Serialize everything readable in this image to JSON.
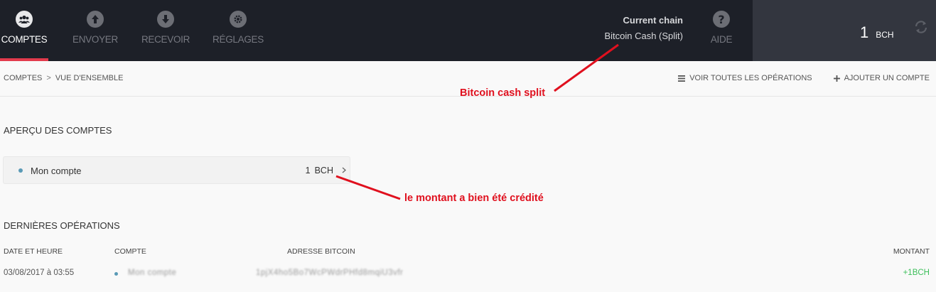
{
  "nav": {
    "items": [
      {
        "label": "COMPTES",
        "icon": "users-icon",
        "active": true
      },
      {
        "label": "ENVOYER",
        "icon": "arrow-up-icon",
        "active": false
      },
      {
        "label": "RECEVOIR",
        "icon": "arrow-down-icon",
        "active": false
      },
      {
        "label": "RÉGLAGES",
        "icon": "gear-icon",
        "active": false
      }
    ],
    "chain_title": "Current chain",
    "chain_value": "Bitcoin Cash (Split)",
    "help": {
      "label": "AIDE",
      "icon": "question-icon"
    },
    "balance_amount": "1",
    "balance_unit": "BCH",
    "refresh_icon": "refresh-icon"
  },
  "breadcrumb": {
    "root": "COMPTES",
    "separator": ">",
    "current": "VUE D'ENSEMBLE"
  },
  "actions": {
    "view_all": "VOIR TOUTES LES OPÉRATIONS",
    "add_account": "AJOUTER UN COMPTE"
  },
  "overview": {
    "title": "APERÇU DES COMPTES",
    "account": {
      "name": "Mon compte",
      "amount": "1",
      "unit": "BCH"
    }
  },
  "operations": {
    "title": "DERNIÈRES OPÉRATIONS",
    "columns": {
      "date": "DATE ET HEURE",
      "account": "COMPTE",
      "address": "ADRESSE BITCOIN",
      "amount": "MONTANT"
    },
    "rows": [
      {
        "date": "03/08/2017 à 03:55",
        "account": "Mon compte",
        "address": "1pjX4ho5Bo7WcPWdrPHfd8mqiU3vfr",
        "amount": "+1BCH"
      }
    ]
  },
  "annotations": {
    "chain_note": "Bitcoin cash split",
    "amount_note": "le montant a bien été crédité"
  },
  "colors": {
    "nav_bg": "#1d2028",
    "accent": "#e23a4c",
    "annotation": "#e0101e",
    "positive": "#3dbf5a",
    "account_dot": "#5a9ab6"
  }
}
